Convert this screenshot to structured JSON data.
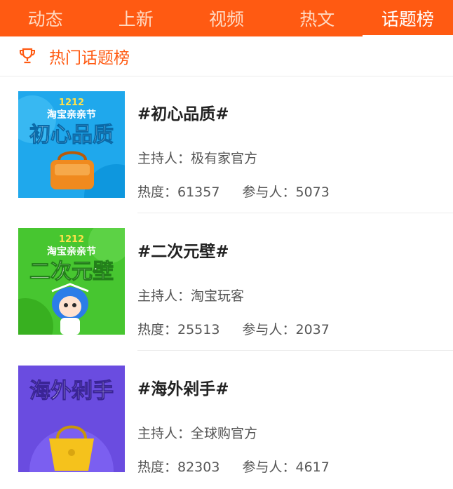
{
  "tabs": [
    {
      "label": "动态"
    },
    {
      "label": "上新"
    },
    {
      "label": "视频"
    },
    {
      "label": "热文"
    },
    {
      "label": "话题榜",
      "active": true
    }
  ],
  "section": {
    "title": "热门话题榜",
    "icon": "trophy-icon"
  },
  "colors": {
    "brand": "#ff5a12",
    "text": "#222222",
    "muted": "#555555"
  },
  "topics": [
    {
      "title": "#初心品质#",
      "host": "主持人：极有家官方",
      "heat": "热度：61357",
      "participants": "参与人：5073",
      "image": {
        "badge": "1212",
        "festival": "淘宝亲亲节",
        "headline": "初心品质",
        "bg": "#1fa8ec"
      }
    },
    {
      "title": "#二次元壁#",
      "host": "主持人：淘宝玩客",
      "heat": "热度：25513",
      "participants": "参与人：2037",
      "image": {
        "badge": "1212",
        "festival": "淘宝亲亲节",
        "headline": "二次元壁",
        "bg": "#47c630"
      }
    },
    {
      "title": "#海外剁手#",
      "host": "主持人：全球购官方",
      "heat": "热度：82303",
      "participants": "参与人：4617",
      "image": {
        "headline": "海外剁手",
        "bg": "#6a4ce0"
      }
    }
  ]
}
